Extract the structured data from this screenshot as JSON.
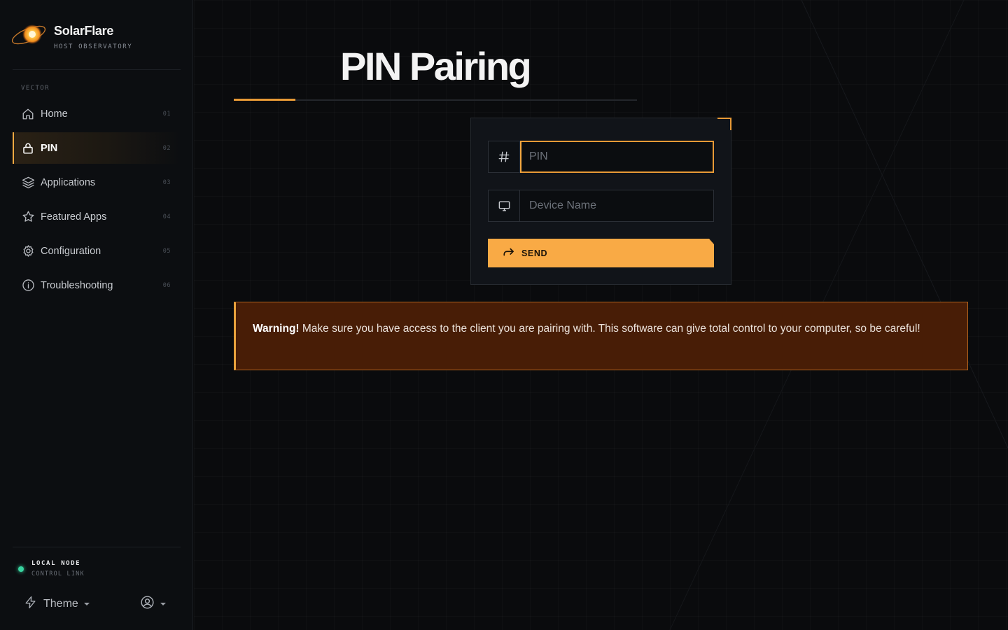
{
  "brand": {
    "name": "SolarFlare",
    "subtitle": "HOST OBSERVATORY"
  },
  "sidebar": {
    "section_label": "VECTOR",
    "items": [
      {
        "label": "Home",
        "index": "01",
        "icon": "home-icon",
        "active": false
      },
      {
        "label": "PIN",
        "index": "02",
        "icon": "lock-icon",
        "active": true
      },
      {
        "label": "Applications",
        "index": "03",
        "icon": "layers-icon",
        "active": false
      },
      {
        "label": "Featured Apps",
        "index": "04",
        "icon": "star-icon",
        "active": false
      },
      {
        "label": "Configuration",
        "index": "05",
        "icon": "gear-icon",
        "active": false
      },
      {
        "label": "Troubleshooting",
        "index": "06",
        "icon": "info-icon",
        "active": false
      }
    ],
    "status": {
      "title": "LOCAL NODE",
      "subtitle": "CONTROL LINK",
      "color": "#38d39f"
    },
    "theme_label": "Theme"
  },
  "main": {
    "title": "PIN Pairing",
    "form": {
      "pin": {
        "placeholder": "PIN",
        "value": "",
        "icon": "hash-icon"
      },
      "device_name": {
        "placeholder": "Device Name",
        "value": "",
        "icon": "monitor-icon"
      },
      "send_label": "SEND"
    },
    "warning": {
      "strong": "Warning!",
      "text": " Make sure you have access to the client you are pairing with. This software can give total control to your computer, so be careful!"
    }
  },
  "colors": {
    "accent": "#f9aa45",
    "background": "#0a0b0d",
    "warning_bg": "#481d06"
  }
}
